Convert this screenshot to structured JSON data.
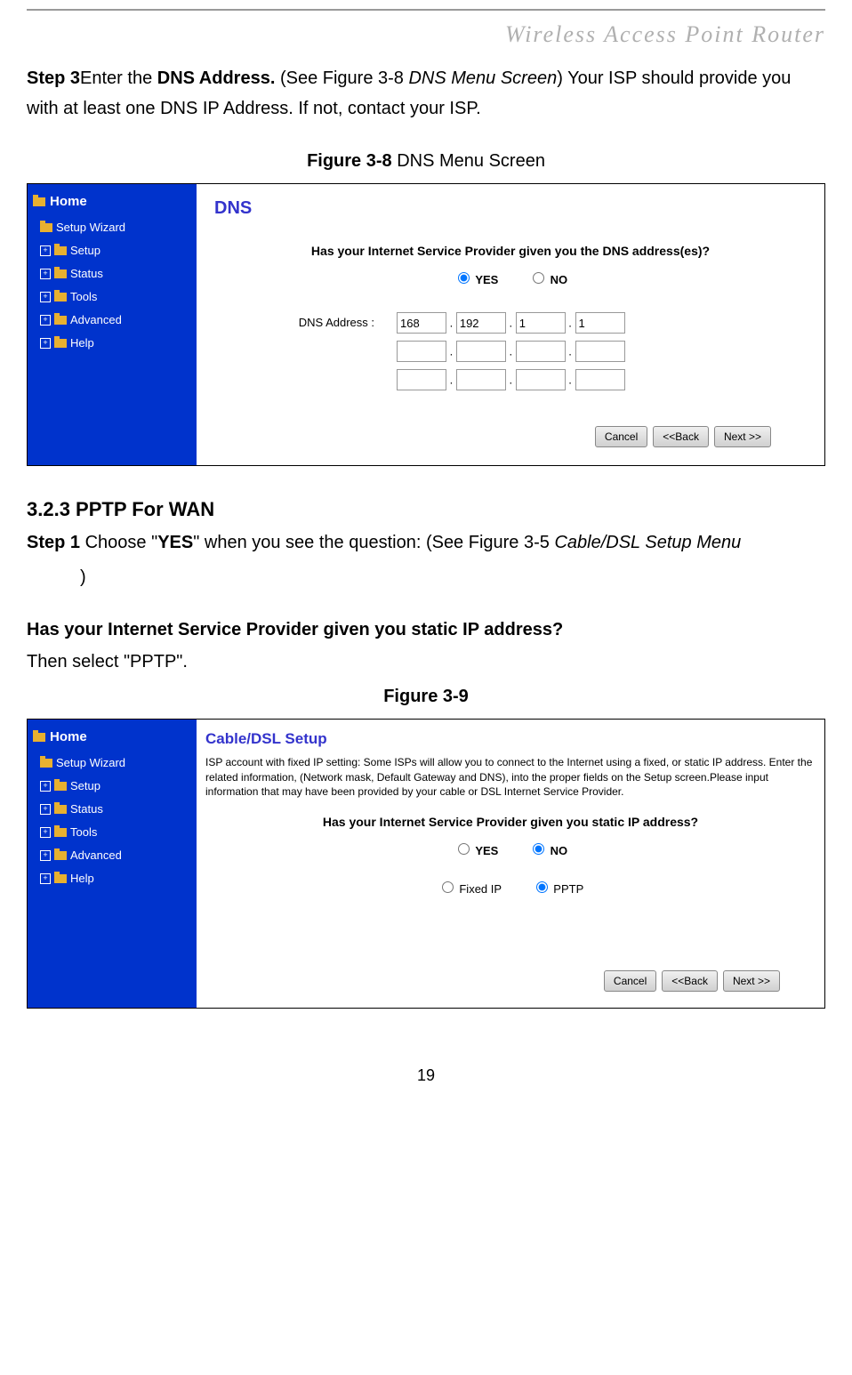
{
  "header": "Wireless Access Point Router",
  "step3": {
    "label": "Step 3",
    "action": "Enter the ",
    "bold_action": "DNS Address.",
    "ref": " (See Figure 3-8 ",
    "ref_italic": "DNS Menu Screen",
    "tail": ") Your ISP should provide you with at least one DNS IP Address. If not, contact your ISP."
  },
  "fig38": {
    "caption_bold": "Figure 3-8",
    "caption_rest": " DNS Menu Screen"
  },
  "sidebar": {
    "home": "Home",
    "items": [
      "Setup Wizard",
      "Setup",
      "Status",
      "Tools",
      "Advanced",
      "Help"
    ]
  },
  "dns_panel": {
    "title": "DNS",
    "question": "Has your Internet Service Provider given you the DNS address(es)?",
    "yes": "YES",
    "no": "NO",
    "address_label": "DNS Address :",
    "row1": [
      "168",
      "192",
      "1",
      "1"
    ],
    "row2": [
      "",
      "",
      "",
      ""
    ],
    "row3": [
      "",
      "",
      "",
      ""
    ],
    "buttons": {
      "cancel": "Cancel",
      "back": "<<Back",
      "next": "Next >>"
    }
  },
  "section323": {
    "heading": "3.2.3 PPTP For WAN",
    "step1_label": "Step 1",
    "step1_text1": " Choose \"",
    "step1_yes": "YES",
    "step1_text2": "\" when you see the question: (See Figure 3-5 ",
    "step1_italic": "Cable/DSL Setup Menu",
    "step1_text3": ")"
  },
  "question_bold": "Has your Internet Service Provider given you static IP address?",
  "then_select": "Then select \"PPTP\".",
  "fig39_caption": "Figure 3-9",
  "cable_panel": {
    "title": "Cable/DSL Setup",
    "desc": "ISP account with fixed IP setting: Some ISPs will allow you to connect to the Internet using a fixed, or static IP address. Enter the related information, (Network mask, Default Gateway and DNS), into the proper fields on the Setup screen.Please input information that may have been provided by your cable or DSL Internet Service Provider.",
    "question": "Has your Internet Service Provider given you static IP address?",
    "yes": "YES",
    "no": "NO",
    "fixedip": "Fixed IP",
    "pptp": "PPTP",
    "buttons": {
      "cancel": "Cancel",
      "back": "<<Back",
      "next": "Next >>"
    }
  },
  "page_number": "19"
}
